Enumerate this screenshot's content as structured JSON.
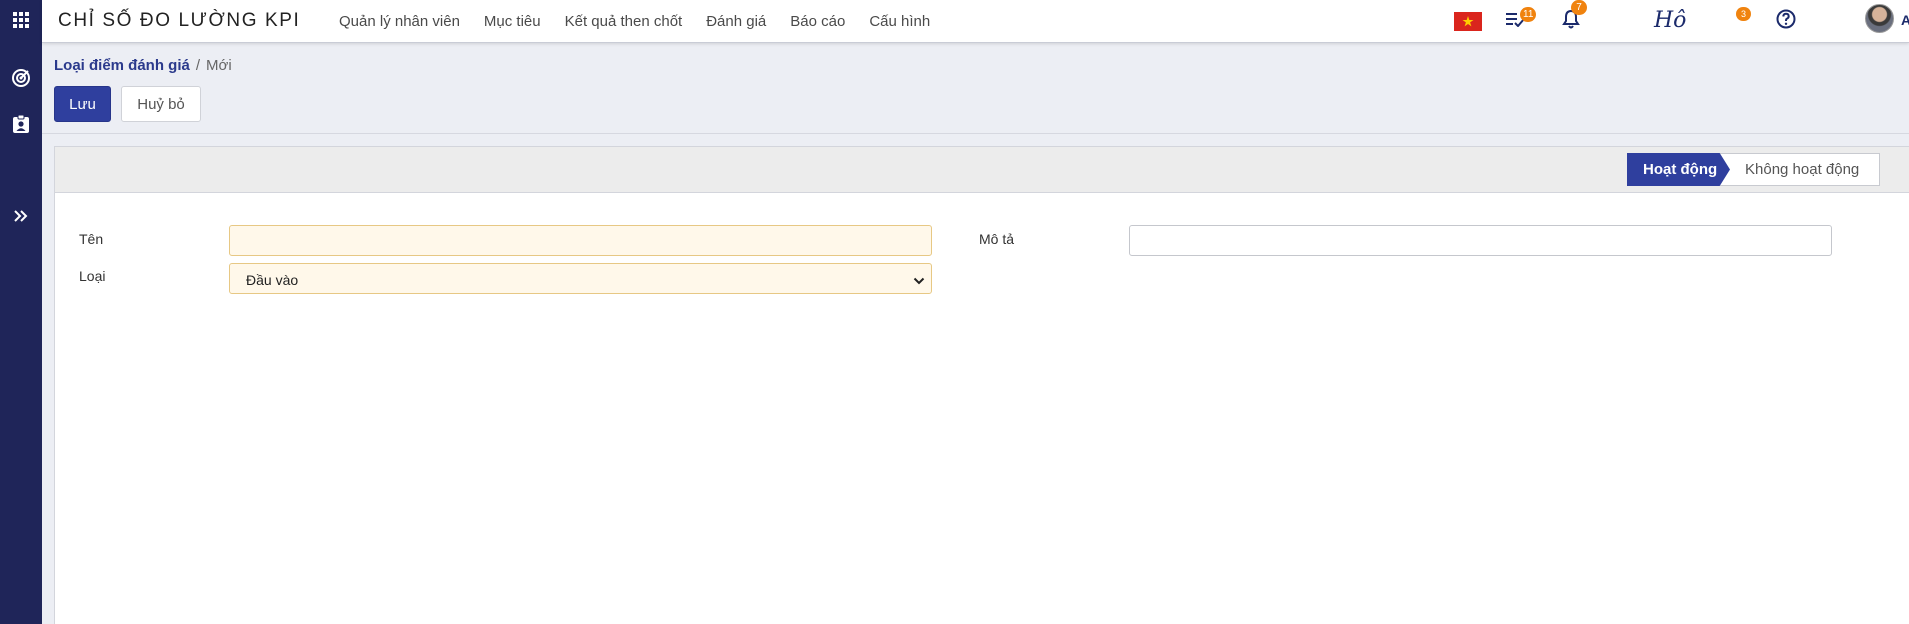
{
  "app": {
    "title": "CHỈ SỐ ĐO LƯỜNG KPI"
  },
  "menu": [
    {
      "label": "Quản lý nhân viên"
    },
    {
      "label": "Mục tiêu"
    },
    {
      "label": "Kết quả then chốt"
    },
    {
      "label": "Đánh giá"
    },
    {
      "label": "Báo cáo"
    },
    {
      "label": "Cấu hình"
    }
  ],
  "systray": {
    "language_flag": "vietnam-flag-icon",
    "activities_count": "11",
    "notifications_count": "7",
    "signature_text": "Hô",
    "extra_count": "3",
    "user_name": "Admin"
  },
  "breadcrumb": {
    "parent": "Loại điểm đánh giá",
    "separator": "/",
    "current": "Mới"
  },
  "buttons": {
    "save": "Lưu",
    "discard": "Huỷ bỏ"
  },
  "status": {
    "active": "Hoạt động",
    "inactive": "Không hoạt động"
  },
  "form": {
    "name_label": "Tên",
    "name_value": "",
    "type_label": "Loại",
    "type_value": "Đầu vào",
    "description_label": "Mô tả",
    "description_value": ""
  },
  "colors": {
    "primary": "#2f3f9e",
    "rail": "#1f2559",
    "badge": "#f0830f",
    "required_field": "#fff8ea"
  },
  "icons": {
    "apps": "grid-icon",
    "module_kpi": "target-icon",
    "module_review": "clipboard-user-icon",
    "expand": "double-chevron-right-icon",
    "activities": "list-check-icon",
    "notifications": "bell-icon",
    "help": "question-circle-icon"
  }
}
